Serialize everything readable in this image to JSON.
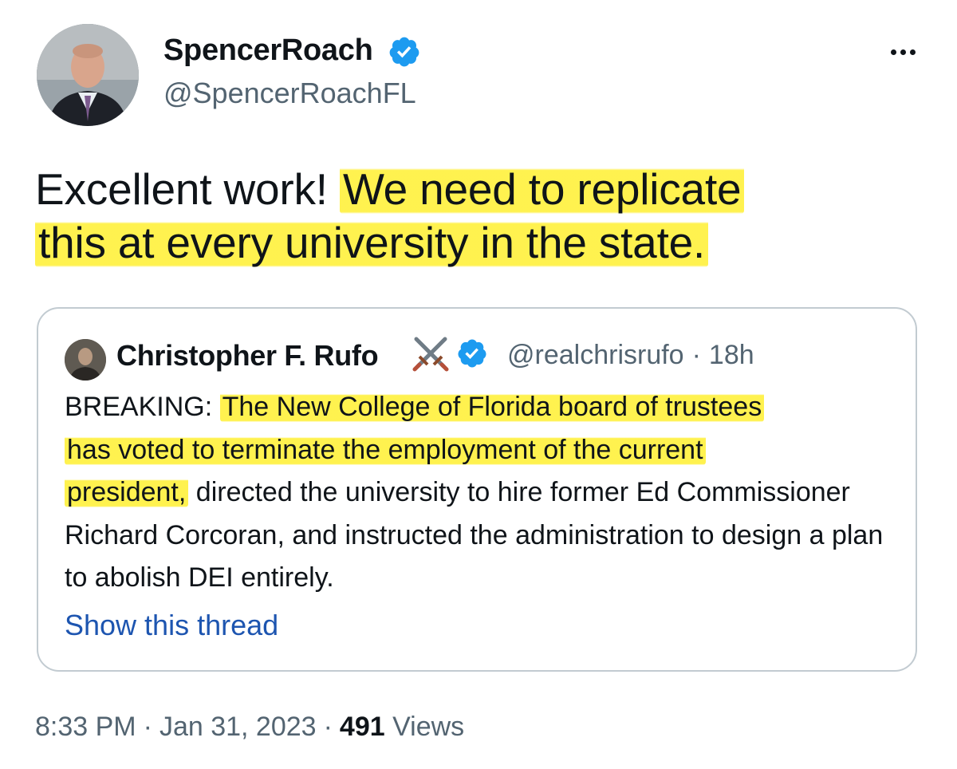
{
  "author": {
    "name": "SpencerRoach",
    "handle": "@SpencerRoachFL",
    "verified": true
  },
  "tweet": {
    "text_plain": "Excellent work!",
    "text_highlight_1": "We need to replicate",
    "text_highlight_2": "this at every university in the state."
  },
  "quoted": {
    "name": "Christopher F. Rufo",
    "handle": "@realchrisrufo",
    "separator": "·",
    "age": "18h",
    "prefix": "BREAKING:",
    "highlight_1": "The New College of Florida board of trustees",
    "highlight_2": "has voted to terminate the employment of the current",
    "highlight_3": "president,",
    "rest": "directed the university to hire former Ed Commissioner Richard Corcoran, and instructed the administration to design a plan to abolish DEI entirely.",
    "show_thread": "Show this thread"
  },
  "meta": {
    "time": "8:33 PM",
    "separator": "·",
    "date": "Jan 31, 2023",
    "views_count": "491",
    "views_label": "Views"
  },
  "icons": {
    "verified": "verified-badge-icon",
    "swords": "crossed-swords-icon",
    "more": "more-options-icon"
  },
  "colors": {
    "highlight": "#fff03c",
    "verified": "#1d9bf0",
    "link": "#1d55b0",
    "secondary_text": "#536471"
  }
}
